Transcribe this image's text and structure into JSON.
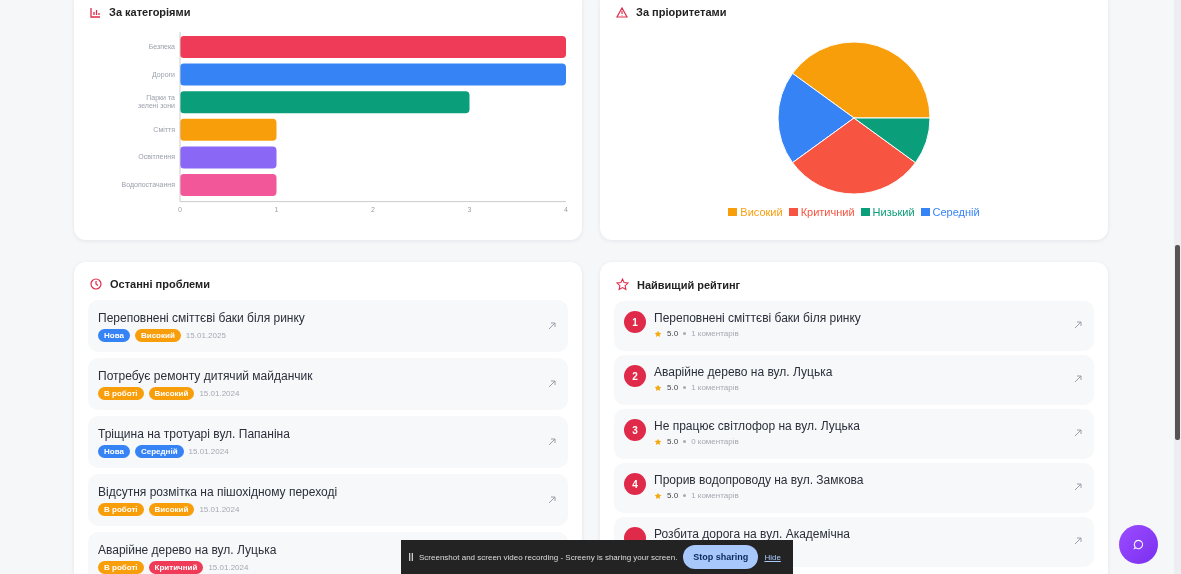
{
  "categories_card": {
    "title": "За категоріями",
    "chart_data": {
      "type": "bar",
      "orientation": "horizontal",
      "categories": [
        "Безпека",
        "Дороги",
        "Парки та зелені зони",
        "Сміття",
        "Освітлення",
        "Водопостачання"
      ],
      "series": [
        {
          "colors": [
            "#ef3b57",
            "#3683f6",
            "#0a9e7b",
            "#f99e0b",
            "#8a67f5",
            "#f2579a"
          ],
          "values": [
            4,
            4,
            3,
            1,
            1,
            1
          ]
        }
      ],
      "xlim": [
        0,
        4
      ],
      "xticks": [
        0,
        1,
        2,
        3,
        4
      ]
    }
  },
  "priorities_card": {
    "title": "За пріоритетами",
    "chart_data": {
      "type": "pie",
      "categories": [
        "Високий",
        "Критичний",
        "Низький",
        "Середній"
      ],
      "series": [
        {
          "colors": [
            "#f99e0b",
            "#f85442",
            "#0a9e7b",
            "#3683f6"
          ],
          "values": [
            40,
            30,
            10,
            20
          ]
        }
      ]
    }
  },
  "recent_card": {
    "title": "Останні проблеми",
    "items": [
      {
        "title": "Переповнені сміттєві баки біля ринку",
        "status": {
          "label": "Нова",
          "color": "#3683f6"
        },
        "priority": {
          "label": "Високий",
          "color": "#f99e0b"
        },
        "date": "15.01.2025"
      },
      {
        "title": "Потребує ремонту дитячий майданчик",
        "status": {
          "label": "В роботі",
          "color": "#f99e0b"
        },
        "priority": {
          "label": "Високий",
          "color": "#f99e0b"
        },
        "date": "15.01.2024"
      },
      {
        "title": "Тріщина на тротуарі вул. Папаніна",
        "status": {
          "label": "Нова",
          "color": "#3683f6"
        },
        "priority": {
          "label": "Середній",
          "color": "#3683f6"
        },
        "date": "15.01.2024"
      },
      {
        "title": "Відсутня розмітка на пішохідному переході",
        "status": {
          "label": "В роботі",
          "color": "#f99e0b"
        },
        "priority": {
          "label": "Високий",
          "color": "#f99e0b"
        },
        "date": "15.01.2024"
      },
      {
        "title": "Аварійне дерево на вул. Луцька",
        "status": {
          "label": "В роботі",
          "color": "#f99e0b"
        },
        "priority": {
          "label": "Критичний",
          "color": "#ef3b57"
        },
        "date": "15.01.2024"
      }
    ]
  },
  "rating_card": {
    "title": "Найвищий рейтинг",
    "items": [
      {
        "rank": "1",
        "title": "Переповнені сміттєві баки біля ринку",
        "rating": "5.0",
        "comments": "1 коментарів"
      },
      {
        "rank": "2",
        "title": "Аварійне дерево на вул. Луцька",
        "rating": "5.0",
        "comments": "1 коментарів"
      },
      {
        "rank": "3",
        "title": "Не працює світлофор на вул. Луцька",
        "rating": "5.0",
        "comments": "0 коментарів"
      },
      {
        "rank": "4",
        "title": "Прорив водопроводу на вул. Замкова",
        "rating": "5.0",
        "comments": "1 коментарів"
      },
      {
        "title": "Розбита дорога на вул. Академічна"
      }
    ]
  },
  "sharing_bar": {
    "message": "Screenshot and screen video recording - Screeny is sharing your screen.",
    "stop_button": "Stop sharing",
    "hide_link": "Hide"
  }
}
